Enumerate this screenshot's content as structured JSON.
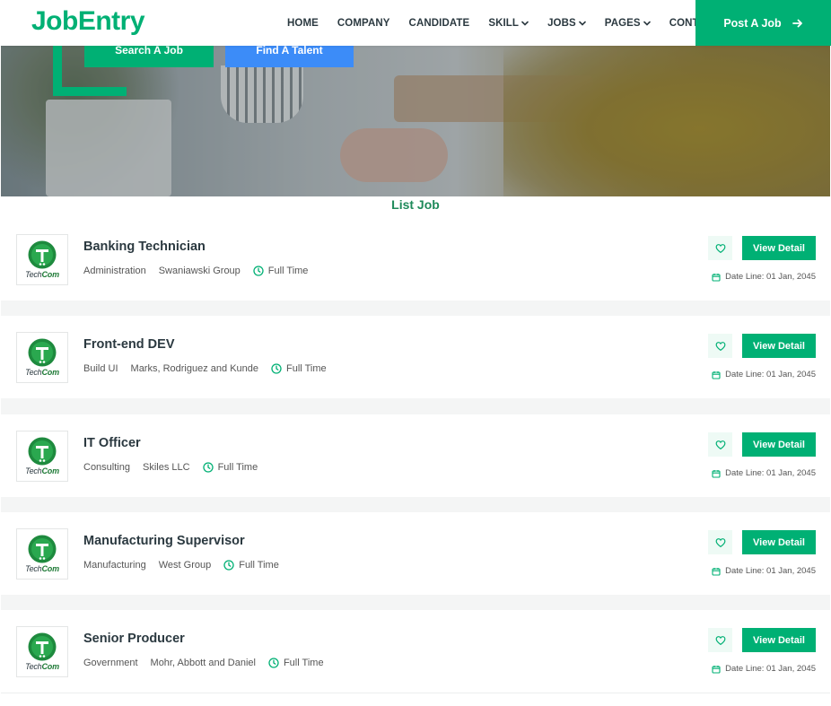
{
  "brand": "JobEntry",
  "nav": {
    "items": [
      {
        "label": "HOME",
        "dropdown": false
      },
      {
        "label": "COMPANY",
        "dropdown": false
      },
      {
        "label": "CANDIDATE",
        "dropdown": false
      },
      {
        "label": "SKILL",
        "dropdown": true
      },
      {
        "label": "JOBS",
        "dropdown": true
      },
      {
        "label": "PAGES",
        "dropdown": true
      },
      {
        "label": "CONTACT",
        "dropdown": false
      }
    ],
    "post_job_label": "Post A Job"
  },
  "hero": {
    "search_label": "Search A Job",
    "talent_label": "Find A Talent"
  },
  "section_title": "List Job",
  "colors": {
    "accent": "#00b074",
    "blue": "#3c8cf8",
    "dark": "#2b3940"
  },
  "jobs": [
    {
      "title": "Banking Technician",
      "category": "Administration",
      "company": "Swaniawski Group",
      "type": "Full Time",
      "deadline": "Date Line: 01 Jan, 2045",
      "logo_text_1": "Tech",
      "logo_text_2": "Com"
    },
    {
      "title": "Front-end DEV",
      "category": "Build UI",
      "company": "Marks, Rodriguez and Kunde",
      "type": "Full Time",
      "deadline": "Date Line: 01 Jan, 2045",
      "logo_text_1": "Tech",
      "logo_text_2": "Com"
    },
    {
      "title": "IT Officer",
      "category": "Consulting",
      "company": "Skiles LLC",
      "type": "Full Time",
      "deadline": "Date Line: 01 Jan, 2045",
      "logo_text_1": "Tech",
      "logo_text_2": "Com"
    },
    {
      "title": "Manufacturing Supervisor",
      "category": "Manufacturing",
      "company": "West Group",
      "type": "Full Time",
      "deadline": "Date Line: 01 Jan, 2045",
      "logo_text_1": "Tech",
      "logo_text_2": "Com"
    },
    {
      "title": "Senior Producer",
      "category": "Government",
      "company": "Mohr, Abbott and Daniel",
      "type": "Full Time",
      "deadline": "Date Line: 01 Jan, 2045",
      "logo_text_1": "Tech",
      "logo_text_2": "Com"
    }
  ],
  "view_detail_label": "View Detail"
}
